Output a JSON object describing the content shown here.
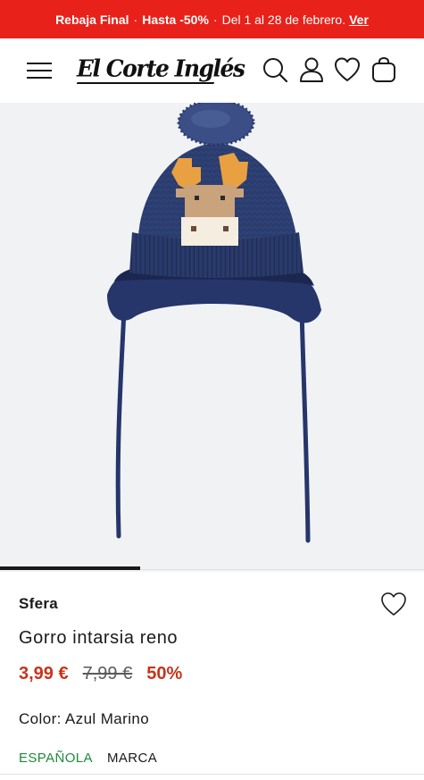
{
  "promo": {
    "title": "Rebaja Final",
    "separator": "·",
    "discount": "Hasta -50%",
    "dates": "Del 1 al 28 de febrero.",
    "link": "Ver",
    "background": "#e8211a"
  },
  "header": {
    "menu_icon": "hamburger-menu-icon",
    "logo": "El Corte Inglés",
    "icons": [
      "search-icon",
      "user-icon",
      "heart-icon",
      "bag-icon"
    ]
  },
  "gallery": {
    "image": "product-photo",
    "progress": 0.33
  },
  "product": {
    "brand": "Sfera",
    "name": "Gorro intarsia reno",
    "price_current": "3,99 €",
    "price_old": "7,99 €",
    "discount": "50%",
    "color_label": "Color: Azul Marino",
    "tag_origin": "ESPAÑOLA",
    "tag_brand": "MARCA",
    "favorite_icon": "heart-outline-icon"
  },
  "colors": {
    "accent": "#c8341a",
    "origin_green": "#1e8a3a",
    "hat_navy": "#2b3c6e"
  }
}
